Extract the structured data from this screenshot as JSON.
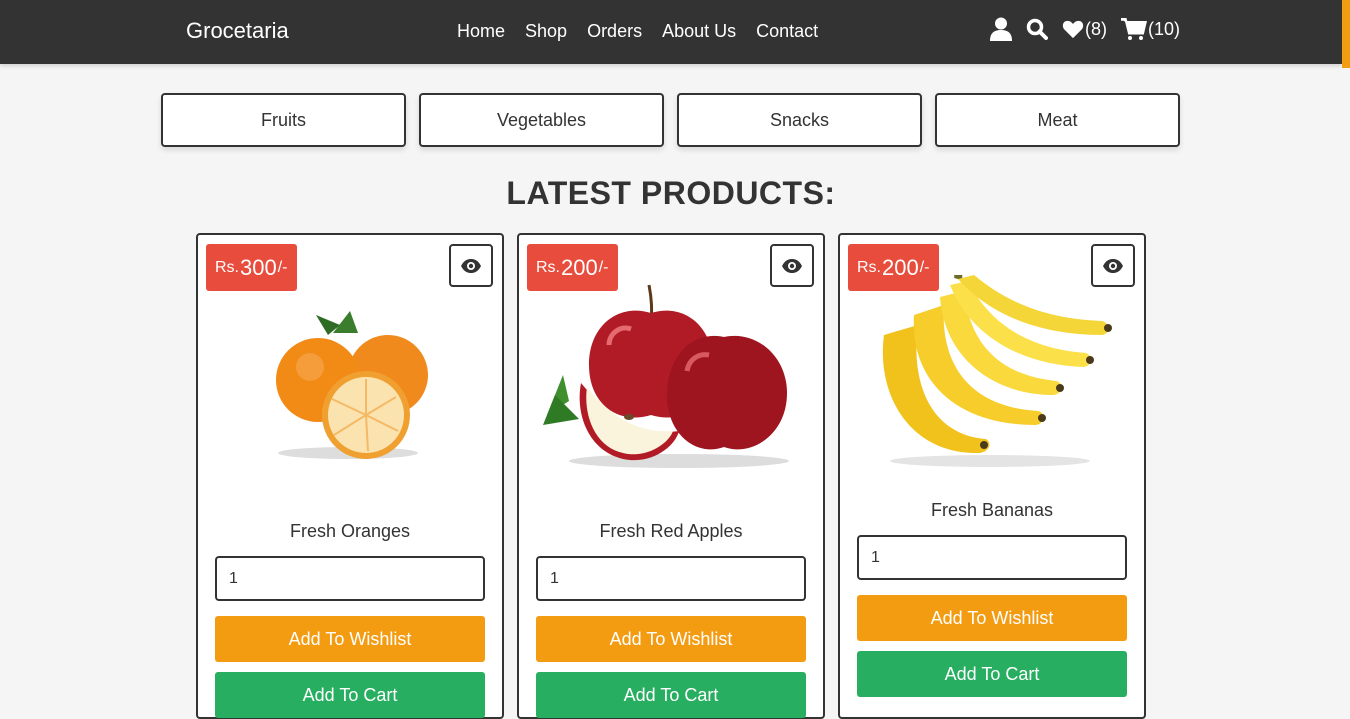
{
  "header": {
    "logo": "Grocetaria",
    "nav": [
      "Home",
      "Shop",
      "Orders",
      "About Us",
      "Contact"
    ],
    "wishlist_count": "(8)",
    "cart_count": "(10)"
  },
  "categories": [
    "Fruits",
    "Vegetables",
    "Snacks",
    "Meat"
  ],
  "section_title": "LATEST PRODUCTS:",
  "products": [
    {
      "currency": "Rs.",
      "price": "300",
      "suffix": "/-",
      "name": "Fresh Oranges",
      "qty": "1",
      "wishlist_label": "Add To Wishlist",
      "cart_label": "Add To Cart"
    },
    {
      "currency": "Rs.",
      "price": "200",
      "suffix": "/-",
      "name": "Fresh Red Apples",
      "qty": "1",
      "wishlist_label": "Add To Wishlist",
      "cart_label": "Add To Cart"
    },
    {
      "currency": "Rs.",
      "price": "200",
      "suffix": "/-",
      "name": "Fresh Bananas",
      "qty": "1",
      "wishlist_label": "Add To Wishlist",
      "cart_label": "Add To Cart"
    }
  ],
  "colors": {
    "header": "#333333",
    "price_badge": "#e74c3c",
    "wishlist": "#f39c12",
    "cart": "#27ae60"
  }
}
